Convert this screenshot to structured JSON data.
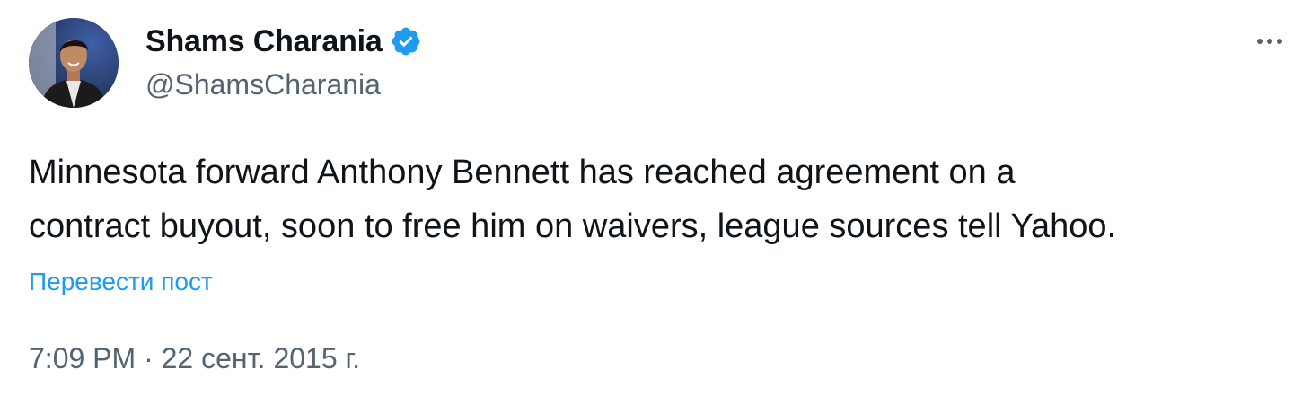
{
  "author": {
    "display_name": "Shams Charania",
    "handle": "@ShamsCharania",
    "verified": true,
    "avatar_icon": "profile-photo"
  },
  "menu": {
    "more_icon": "more-options-icon"
  },
  "tweet": {
    "text": "Minnesota forward Anthony Bennett has reached agreement on a\ncontract buyout, soon to free him on waivers, league sources tell Yahoo.",
    "translate_label": "Перевести пост",
    "time": "7:09 PM",
    "separator": "·",
    "date": "22 сент. 2015 г."
  },
  "colors": {
    "text_primary": "#0f1419",
    "text_secondary": "#536471",
    "link": "#1d9bf0",
    "verified_badge": "#1d9bf0"
  }
}
